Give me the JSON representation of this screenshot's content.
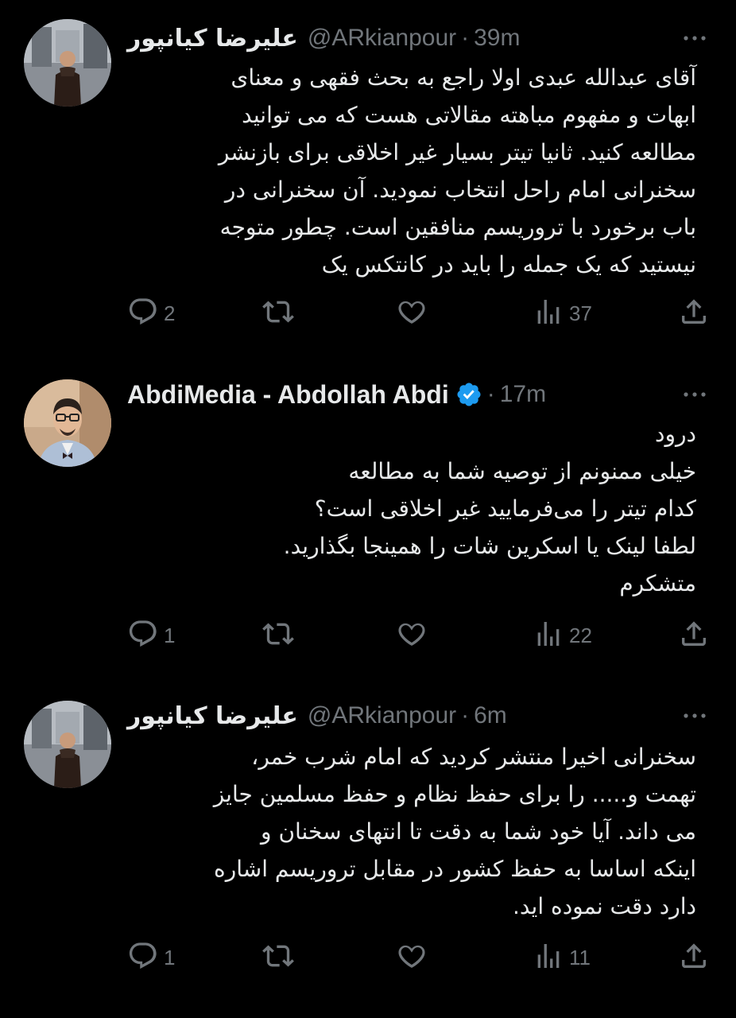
{
  "tweets": [
    {
      "name": "علیرضا کیانپور",
      "handle": "@ARkianpour",
      "separator": "·",
      "time": "39m",
      "verified": false,
      "text": "آقای عبدالله عبدی اولا راجع به بحث فقهی و معنای\nابهات و مفهوم مباهته مقالاتی هست که می توانید\nمطالعه کنید. ثانیا تیتر بسیار غیر اخلاقی برای بازنشر\nسخنرانی امام راحل انتخاب نمودید. آن سخنرانی در\nباب برخورد با تروریسم منافقین است. چطور متوجه\nنیستید که یک جمله را باید در کانتکس یک",
      "replies": "2",
      "retweets": "",
      "likes": "",
      "views": "37"
    },
    {
      "name": "AbdiMedia - Abdollah Abdi",
      "handle": "",
      "separator": "·",
      "time": "17m",
      "verified": true,
      "text": "درود\nخیلی ممنونم از توصیه شما به مطالعه\nکدام تیتر را می‌فرمایید غیر اخلاقی است؟\nلطفا لینک یا اسکرین شات را همینجا بگذارید.\nمتشکرم",
      "replies": "1",
      "retweets": "",
      "likes": "",
      "views": "22"
    },
    {
      "name": "علیرضا کیانپور",
      "handle": "@ARkianpour",
      "separator": "·",
      "time": "6m",
      "verified": false,
      "text": "سخنرانی اخیرا منتشر کردید که امام شرب خمر،\nتهمت و..... را برای حفظ نظام و حفظ مسلمین جایز\nمی داند. آیا خود شما به دقت تا انتهای سخنان و\nاینکه اساسا به حفظ کشور در مقابل تروریسم اشاره\nدارد دقت نموده اید.",
      "replies": "1",
      "retweets": "",
      "likes": "",
      "views": "11"
    }
  ],
  "icons": {
    "reply": "reply-icon",
    "retweet": "retweet-icon",
    "like": "heart-icon",
    "views": "views-icon",
    "share": "share-icon",
    "more": "more-icon",
    "verified": "verified-badge-icon"
  },
  "colors": {
    "background": "#000000",
    "text": "#e7e9ea",
    "muted": "#71767b",
    "verified": "#1d9bf0"
  }
}
